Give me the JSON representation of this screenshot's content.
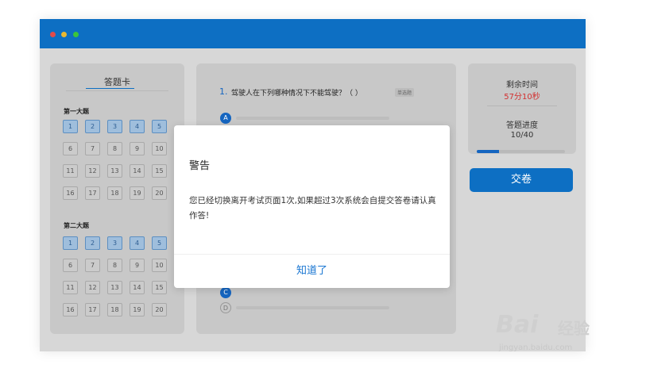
{
  "card": {
    "title": "答题卡",
    "sections": [
      {
        "label": "第一大题",
        "cells": [
          "1",
          "2",
          "3",
          "4",
          "5",
          "6",
          "7",
          "8",
          "9",
          "10",
          "11",
          "12",
          "13",
          "14",
          "15",
          "16",
          "17",
          "18",
          "19",
          "20"
        ],
        "answered_count": 5
      },
      {
        "label": "第二大题",
        "cells": [
          "1",
          "2",
          "3",
          "4",
          "5",
          "6",
          "7",
          "8",
          "9",
          "10",
          "11",
          "12",
          "13",
          "14",
          "15",
          "16",
          "17",
          "18",
          "19",
          "20"
        ],
        "answered_count": 5
      }
    ]
  },
  "question": {
    "number": "1.",
    "text": "驾驶人在下列哪种情况下不能驾驶？（ ）",
    "tag": "单选题",
    "options": {
      "a": "A",
      "c": "C",
      "d": "D"
    }
  },
  "side": {
    "time_label": "剩余时间",
    "time_value": "57分10秒",
    "progress_label": "答题进度",
    "progress_value": "10/40",
    "progress_fraction": 0.25
  },
  "submit_label": "交卷",
  "modal": {
    "title": "警告",
    "body": "您已经切换离开考试页面1次,如果超过3次系统会自提交答卷请认真作答!",
    "button": "知道了"
  },
  "watermark": {
    "logo": "Bai",
    "brand": "经验",
    "url": "jingyan.baidu.com"
  },
  "colors": {
    "accent": "#0d6fc3",
    "time": "#d32f2f"
  }
}
